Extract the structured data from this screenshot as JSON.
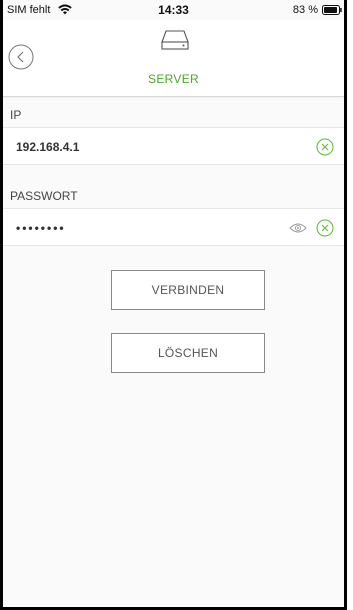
{
  "status_bar": {
    "carrier": "SIM fehlt",
    "time": "14:33",
    "battery": "83 %"
  },
  "header": {
    "title": "SERVER",
    "title_color": "#4aa82a",
    "icons": {
      "back": "chevron-left-circle-icon",
      "server": "server-icon"
    }
  },
  "form": {
    "ip": {
      "label": "IP",
      "value": "192.168.4.1"
    },
    "password": {
      "label": "PASSWORT",
      "value": "••••••••"
    },
    "icons": {
      "clear": "clear-circle-icon",
      "eye": "eye-icon"
    }
  },
  "buttons": {
    "connect": "VERBINDEN",
    "delete": "LÖSCHEN"
  }
}
